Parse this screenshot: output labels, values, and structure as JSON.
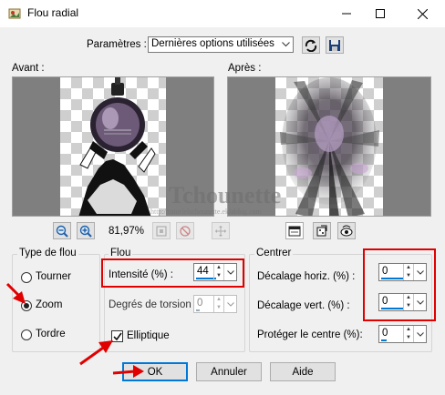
{
  "window": {
    "title": "Flou radial",
    "minimize_icon": "minimize-icon",
    "maximize_icon": "maximize-icon",
    "close_icon": "close-icon"
  },
  "params": {
    "label": "Paramètres :",
    "preset_value": "Dernières options utilisées"
  },
  "preview": {
    "before_label": "Avant :",
    "after_label": "Après :",
    "zoom_level": "81,97%",
    "watermark_title": "Tchounette",
    "watermark_url": "http://tutorielschounette.eklablog.com"
  },
  "blur_type": {
    "title": "Type de flou",
    "options": [
      "Tourner",
      "Zoom",
      "Tordre"
    ],
    "selected": "Zoom"
  },
  "flou": {
    "title": "Flou",
    "intensity_label": "Intensité (%) :",
    "intensity_value": "44",
    "torsion_label": "Degrés de torsion :",
    "torsion_value": "0",
    "elliptic_label": "Elliptique",
    "elliptic_checked": true
  },
  "center": {
    "title": "Centrer",
    "h_offset_label": "Décalage horiz. (%) :",
    "h_offset_value": "0",
    "v_offset_label": "Décalage vert. (%) :",
    "v_offset_value": "0",
    "protect_label": "Protéger le centre (%):",
    "protect_value": "0"
  },
  "buttons": {
    "ok": "OK",
    "cancel": "Annuler",
    "help": "Aide"
  },
  "annotations": {
    "highlight_color": "#e00000",
    "accent_color": "#0078d7"
  }
}
